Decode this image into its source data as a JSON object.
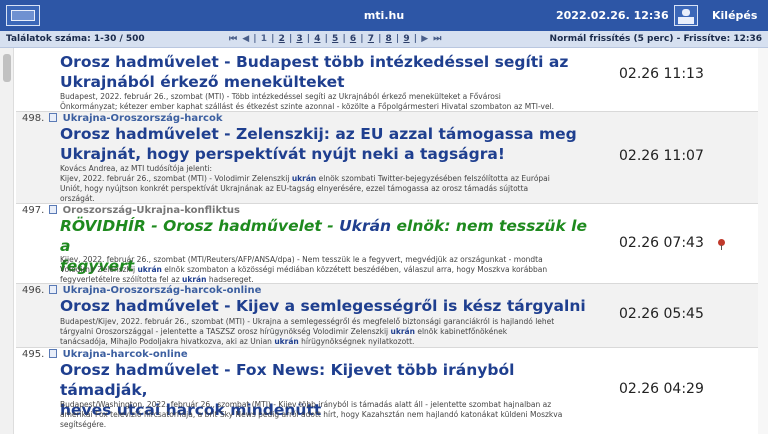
{
  "topbar": {
    "site": "mti.hu",
    "datetime": "2022.02.26. 12:36",
    "logout": "Kilépés"
  },
  "navbar": {
    "count": "Találatok száma: 1-30 / 500",
    "pager": {
      "first": "⏮",
      "prev": "◀",
      "pages": [
        "1",
        "2",
        "3",
        "4",
        "5",
        "6",
        "7",
        "8",
        "9"
      ],
      "current": "1",
      "next": "▶",
      "last": "⏭"
    },
    "refresh": "Normál frissítés (5 perc) - Frissítve: 12:36"
  },
  "items": [
    {
      "num": "",
      "tag": "",
      "title_lines": [
        "Orosz hadművelet - Budapest több intézkedéssel segíti az",
        "Ukrajnából érkező menekülteket"
      ],
      "lead_lines": [
        "Budapest, 2022. február 26., szombat (MTI) - Több intézkedéssel segíti az Ukrajnából érkező menekülteket a Fővárosi",
        "Önkormányzat; kétezer ember kaphat szállást és étkezést szinte azonnal - közölte a Főpolgármesteri Hivatal szombaton az MTI-vel."
      ],
      "time": "02.26 11:13"
    },
    {
      "num": "498.",
      "tag": "Ukrajna-Oroszország-harcok",
      "title_lines": [
        "Orosz hadművelet - Zelenszkij: az EU azzal támogassa meg",
        "Ukrajnát, hogy perspektívát nyújt neki a tagságra!"
      ],
      "lead_lines": [
        "Kovács Andrea, az MTI tudósítója jelenti:",
        "Kijev, 2022. február 26., szombat (MTI) - Volodimir Zelenszkij ukrán elnök szombati Twitter-bejegyzésében felszólította az Európai",
        "Uniót, hogy nyújtson konkrét perspektívát Ukrajnának az EU-tagság elnyerésére, ezzel támogassa az orosz támadás sújtotta",
        "országát."
      ],
      "time": "02.26 11:07"
    },
    {
      "num": "497.",
      "tag": "Oroszország-Ukrajna-konfliktus",
      "title_prefix": "RÖVIDHÍR - Orosz hadművelet - ",
      "title_kw": "Ukrán",
      "title_rest": " elnök: nem tesszük le a",
      "title_line2": "fegyvert",
      "lead_lines": [
        "Kijev, 2022. február 26., szombat (MTI/Reuters/AFP/ANSA/dpa) - Nem tesszük le a fegyvert, megvédjük az országunkat - mondta",
        "Volodimir Zelenszkij ukrán elnök szombaton a közösségi médiában közzétett beszédében, válaszul arra, hogy Moszkva korábban",
        "fegyverletételre szólította fel az ukrán hadsereget."
      ],
      "time": "02.26 07:43"
    },
    {
      "num": "496.",
      "tag": "Ukrajna-Oroszország-harcok-online",
      "title_lines": [
        "Orosz hadművelet - Kijev a semlegességről is kész tárgyalni"
      ],
      "lead_lines": [
        "Budapest/Kijev, 2022. február 26., szombat (MTI) - Ukrajna a semlegességről és megfelelő biztonsági garanciákról is hajlandó lehet",
        "tárgyalni Oroszországgal - jelentette a TASZSZ orosz hírügynökség Volodimir Zelenszkij ukrán elnök kabinetfőnökének",
        "tanácsadója, Mihajlo Podoljakra hivatkozva, aki az Unian ukrán hírügynökségnek nyilatkozott."
      ],
      "time": "02.26 05:45"
    },
    {
      "num": "495.",
      "tag": "Ukrajna-harcok-online",
      "title_lines": [
        "Orosz hadművelet - Fox News: Kijevet több irányból támadják,",
        "heves utcai harcok mindenütt"
      ],
      "lead_lines": [
        "Budapest/Washington, 2022. február 26., szombat (MTI) - Kijev több irányból is támadás alatt áll - jelentette szombat hajnalban az",
        "amerikai Fox televízió hírcsatornája, a brit Sky News pedig arról adott hírt, hogy Kazahsztán nem hajlandó katonákat küldeni Moszkva",
        "segítségére."
      ],
      "time": "02.26 04:29"
    }
  ],
  "colors": {
    "topbar": "#2d56a6",
    "navbar": "#d6e0f0",
    "title": "#1f3f8f",
    "flash_title": "#1e8a1e",
    "pin": "#c0392b"
  }
}
